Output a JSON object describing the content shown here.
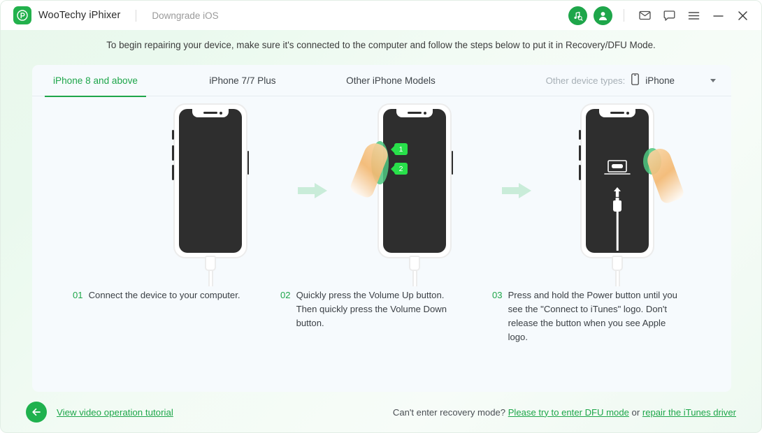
{
  "titlebar": {
    "brand_name": "WooTechy iPhixer",
    "subtitle": "Downgrade iOS",
    "logo_icon": "wootechy-logo-icon",
    "itunes_icon": "music-search-icon",
    "account_icon": "user-avatar-icon",
    "mail_icon": "envelope-icon",
    "feedback_icon": "chat-bubble-icon",
    "menu_icon": "hamburger-menu-icon",
    "minimize_icon": "minimize-icon",
    "close_icon": "close-icon"
  },
  "intro": "To begin repairing your device, make sure it's connected to the computer and follow the steps below to put it in Recovery/DFU Mode.",
  "tabs": [
    {
      "label": "iPhone 8 and above",
      "active": true
    },
    {
      "label": "iPhone 7/7 Plus",
      "active": false
    },
    {
      "label": "Other iPhone Models",
      "active": false
    }
  ],
  "device_type": {
    "label": "Other device types:",
    "icon": "phone-outline-icon",
    "value": "iPhone",
    "caret": "chevron-down-icon"
  },
  "steps": [
    {
      "num": "01",
      "text": "Connect the device to your computer.",
      "illustration": "phone-connected-to-computer"
    },
    {
      "num": "02",
      "text": "Quickly press the Volume Up button. Then quickly press the Volume Down button.",
      "illustration": "phone-press-volume-buttons",
      "badges": [
        "1",
        "2"
      ]
    },
    {
      "num": "03",
      "text": "Press and hold the Power button until you see the \"Connect to iTunes\" logo. Don't release the button when you see Apple logo.",
      "illustration": "phone-connect-to-itunes-screen"
    }
  ],
  "arrows": {
    "icon": "arrow-right-icon",
    "color": "#c9ecd9"
  },
  "footer": {
    "back_icon": "arrow-left-icon",
    "tutorial_link": "View video operation tutorial",
    "question": "Can't enter recovery mode?",
    "dfu_link": "Please try to enter DFU mode",
    "or": "or",
    "itunes_link": "repair the iTunes driver"
  },
  "colors": {
    "brand_green": "#1ea64a",
    "badge_green": "#28e04a",
    "arrow_green": "#c9ecd9",
    "card_bg": "#f6fafd",
    "screen_dark": "#2e2e2e"
  }
}
